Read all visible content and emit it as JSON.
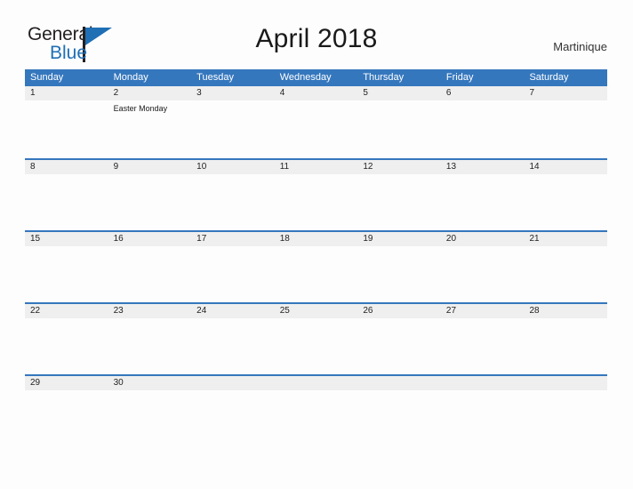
{
  "brand": {
    "name_part1": "General",
    "name_part2": "Blue",
    "flag_icon": "flag-triangle-icon",
    "accent_color": "#1f6fb5"
  },
  "header": {
    "title": "April 2018",
    "location": "Martinique"
  },
  "calendar": {
    "header_bg": "#3577bd",
    "date_band_bg": "#efefef",
    "weekdays": [
      "Sunday",
      "Monday",
      "Tuesday",
      "Wednesday",
      "Thursday",
      "Friday",
      "Saturday"
    ],
    "weeks": [
      {
        "days": [
          {
            "num": "1",
            "events": []
          },
          {
            "num": "2",
            "events": [
              "Easter Monday"
            ]
          },
          {
            "num": "3",
            "events": []
          },
          {
            "num": "4",
            "events": []
          },
          {
            "num": "5",
            "events": []
          },
          {
            "num": "6",
            "events": []
          },
          {
            "num": "7",
            "events": []
          }
        ]
      },
      {
        "days": [
          {
            "num": "8",
            "events": []
          },
          {
            "num": "9",
            "events": []
          },
          {
            "num": "10",
            "events": []
          },
          {
            "num": "11",
            "events": []
          },
          {
            "num": "12",
            "events": []
          },
          {
            "num": "13",
            "events": []
          },
          {
            "num": "14",
            "events": []
          }
        ]
      },
      {
        "days": [
          {
            "num": "15",
            "events": []
          },
          {
            "num": "16",
            "events": []
          },
          {
            "num": "17",
            "events": []
          },
          {
            "num": "18",
            "events": []
          },
          {
            "num": "19",
            "events": []
          },
          {
            "num": "20",
            "events": []
          },
          {
            "num": "21",
            "events": []
          }
        ]
      },
      {
        "days": [
          {
            "num": "22",
            "events": []
          },
          {
            "num": "23",
            "events": []
          },
          {
            "num": "24",
            "events": []
          },
          {
            "num": "25",
            "events": []
          },
          {
            "num": "26",
            "events": []
          },
          {
            "num": "27",
            "events": []
          },
          {
            "num": "28",
            "events": []
          }
        ]
      },
      {
        "days": [
          {
            "num": "29",
            "events": []
          },
          {
            "num": "30",
            "events": []
          },
          {
            "num": "",
            "events": []
          },
          {
            "num": "",
            "events": []
          },
          {
            "num": "",
            "events": []
          },
          {
            "num": "",
            "events": []
          },
          {
            "num": "",
            "events": []
          }
        ]
      }
    ]
  }
}
